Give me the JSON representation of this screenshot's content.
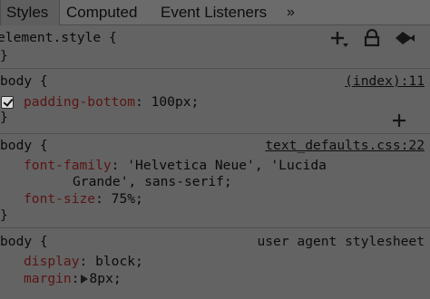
{
  "tabs": {
    "styles": "Styles",
    "computed": "Computed",
    "event_listeners": "Event Listeners",
    "more": "»"
  },
  "rules": [
    {
      "selector_line": "element.style {",
      "close": "}"
    },
    {
      "selector_line": "body {",
      "source": "(index):11",
      "declarations": [
        {
          "property": "padding-bottom",
          "value": "100px;",
          "checked": true
        }
      ],
      "close": "}"
    },
    {
      "selector_line": "body {",
      "source": "text_defaults.css:22",
      "declarations": [
        {
          "property": "font-family",
          "value": "'Helvetica Neue', 'Lucida",
          "value_cont": "Grande', sans-serif;"
        },
        {
          "property": "font-size",
          "value": "75%;"
        }
      ],
      "close": "}"
    },
    {
      "selector_line": "body {",
      "source": "user agent stylesheet",
      "declarations": [
        {
          "property": "display",
          "value": "block;"
        },
        {
          "property": "margin",
          "value": "8px;"
        }
      ]
    }
  ],
  "punct": {
    "colon": ":"
  }
}
